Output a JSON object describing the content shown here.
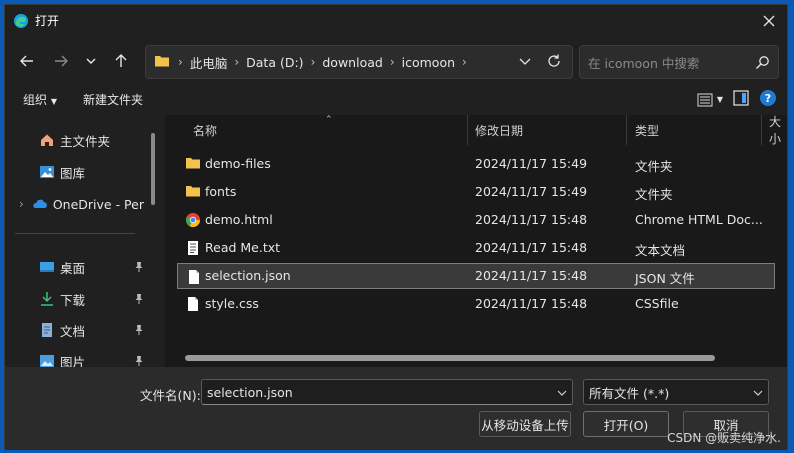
{
  "window": {
    "title": "打开"
  },
  "address": {
    "crumbs": [
      "此电脑",
      "Data (D:)",
      "download",
      "icomoon"
    ]
  },
  "search": {
    "placeholder": "在 icomoon 中搜索"
  },
  "toolbar": {
    "organize": "组织",
    "new_folder": "新建文件夹"
  },
  "sidebar": {
    "items": [
      {
        "label": "主文件夹",
        "icon": "home-icon"
      },
      {
        "label": "图库",
        "icon": "gallery-icon"
      },
      {
        "label": "OneDrive - Per",
        "icon": "cloud-icon"
      },
      {
        "label": "桌面",
        "icon": "desktop-icon"
      },
      {
        "label": "下载",
        "icon": "download-icon"
      },
      {
        "label": "文档",
        "icon": "document-icon"
      },
      {
        "label": "图片",
        "icon": "pictures-icon"
      }
    ]
  },
  "columns": {
    "name": "名称",
    "date": "修改日期",
    "type": "类型",
    "size": "大小"
  },
  "files": [
    {
      "name": "demo-files",
      "date": "2024/11/17 15:49",
      "type": "文件夹",
      "icon": "folder-icon"
    },
    {
      "name": "fonts",
      "date": "2024/11/17 15:49",
      "type": "文件夹",
      "icon": "folder-icon"
    },
    {
      "name": "demo.html",
      "date": "2024/11/17 15:48",
      "type": "Chrome HTML Doc...",
      "icon": "chrome-icon"
    },
    {
      "name": "Read Me.txt",
      "date": "2024/11/17 15:48",
      "type": "文本文档",
      "icon": "text-file-icon"
    },
    {
      "name": "selection.json",
      "date": "2024/11/17 15:48",
      "type": "JSON 文件",
      "icon": "file-icon",
      "selected": true
    },
    {
      "name": "style.css",
      "date": "2024/11/17 15:48",
      "type": "CSSfile",
      "icon": "file-icon"
    }
  ],
  "footer": {
    "filename_label": "文件名(N):",
    "filename_value": "selection.json",
    "filetype_value": "所有文件 (*.*)",
    "upload_button": "从移动设备上传",
    "open_button": "打开(O)",
    "cancel_button": "取消"
  },
  "watermark": "CSDN @贩卖纯净水."
}
